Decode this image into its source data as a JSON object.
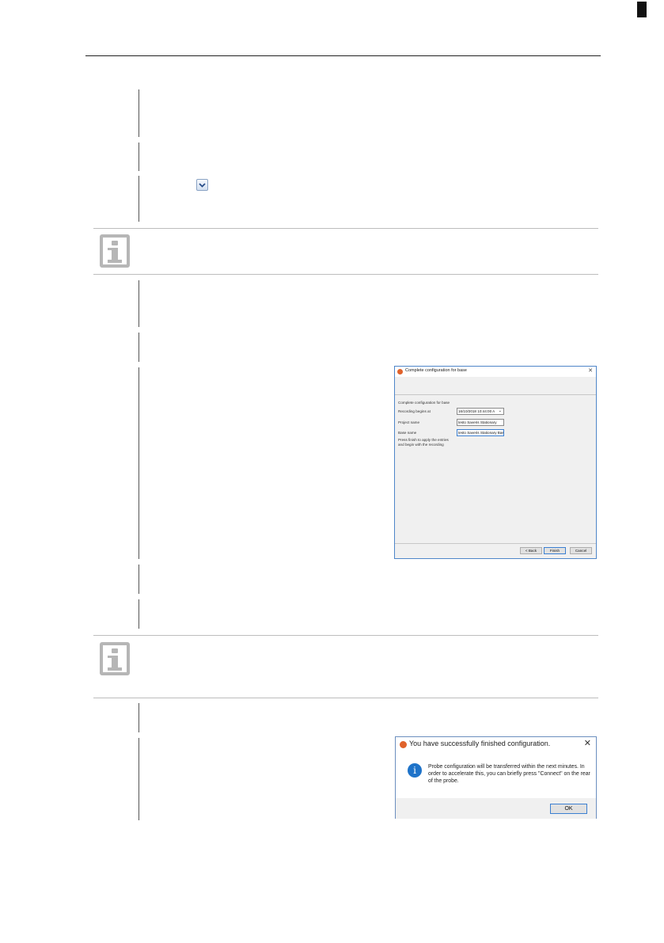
{
  "dialog_config": {
    "title": "Complete configuration for base",
    "heading": "Complete configuration for base",
    "recording_label": "Recording begins at",
    "recording_value": "16/10/2018 10:44:00 A",
    "project_label": "Project name",
    "project_value": "testo Saveris Stationary",
    "base_label": "Base name",
    "base_value": "testo Saveris Stationary Base0",
    "instruction": "Press finish to apply the entries and begin with the recording",
    "back_label": "< Back",
    "finish_label": "Finish",
    "cancel_label": "Cancel",
    "close_glyph": "✕"
  },
  "dialog_success": {
    "title": "You have successfully finished configuration.",
    "message": "Probe configuration will be transferred within the next minutes. In order to accelerate this, you can briefly press \"Connect\" on the rear of the probe.",
    "ok_label": "OK",
    "close_glyph": "✕",
    "info_glyph": "i"
  }
}
